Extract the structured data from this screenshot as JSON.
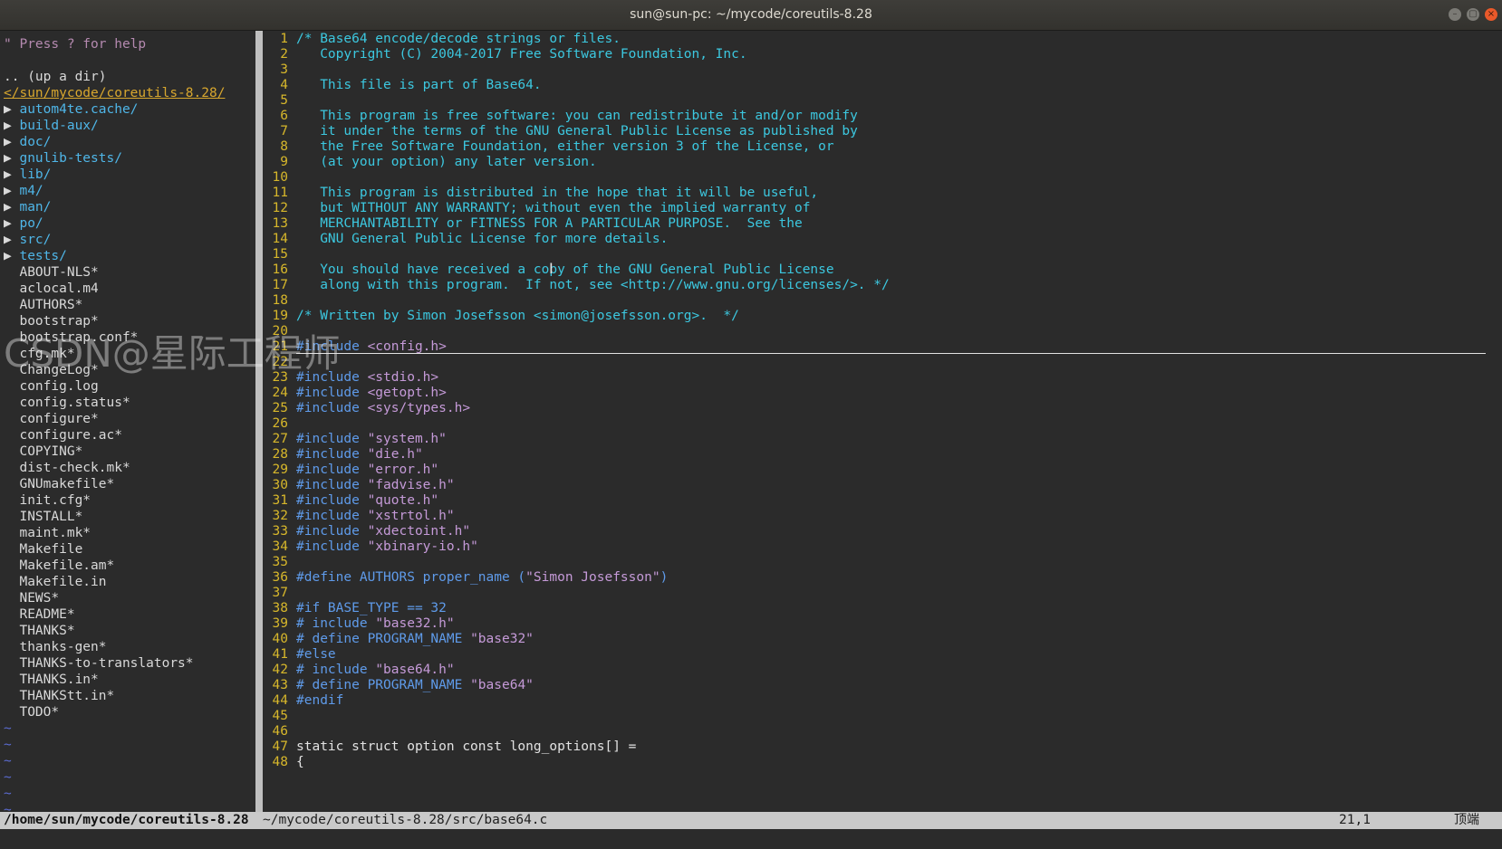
{
  "window": {
    "title": "sun@sun-pc: ~/mycode/coreutils-8.28",
    "controls": {
      "minimize": "–",
      "maximize": "▢",
      "close": "×"
    }
  },
  "tree": {
    "help": "\" Press ? for help",
    "updir": ".. (up a dir)",
    "root": "</sun/mycode/coreutils-8.28/",
    "dirs": [
      "autom4te.cache/",
      "build-aux/",
      "doc/",
      "gnulib-tests/",
      "lib/",
      "m4/",
      "man/",
      "po/",
      "src/",
      "tests/"
    ],
    "dir_arrow": "▶",
    "files": [
      "ABOUT-NLS*",
      "aclocal.m4",
      "AUTHORS*",
      "bootstrap*",
      "bootstrap.conf*",
      "cfg.mk*",
      "ChangeLog*",
      "config.log",
      "config.status*",
      "configure*",
      "configure.ac*",
      "COPYING*",
      "dist-check.mk*",
      "GNUmakefile*",
      "init.cfg*",
      "INSTALL*",
      "maint.mk*",
      "Makefile",
      "Makefile.am*",
      "Makefile.in",
      "NEWS*",
      "README*",
      "THANKS*",
      "thanks-gen*",
      "THANKS-to-translators*",
      "THANKS.in*",
      "THANKStt.in*",
      "TODO*"
    ],
    "tilde": "~"
  },
  "editor": {
    "lines": [
      {
        "n": "1",
        "parts": [
          [
            "c",
            "/* Base64 encode/decode strings or files."
          ]
        ]
      },
      {
        "n": "2",
        "parts": [
          [
            "c",
            "   Copyright (C) 2004-2017 Free Software Foundation, Inc."
          ]
        ]
      },
      {
        "n": "3",
        "parts": []
      },
      {
        "n": "4",
        "parts": [
          [
            "c",
            "   This file is part of Base64."
          ]
        ]
      },
      {
        "n": "5",
        "parts": []
      },
      {
        "n": "6",
        "parts": [
          [
            "c",
            "   This program is free software: you can redistribute it and/or modify"
          ]
        ]
      },
      {
        "n": "7",
        "parts": [
          [
            "c",
            "   it under the terms of the GNU General Public License as published by"
          ]
        ]
      },
      {
        "n": "8",
        "parts": [
          [
            "c",
            "   the Free Software Foundation, either version 3 of the License, or"
          ]
        ]
      },
      {
        "n": "9",
        "parts": [
          [
            "c",
            "   (at your option) any later version."
          ]
        ]
      },
      {
        "n": "10",
        "parts": []
      },
      {
        "n": "11",
        "parts": [
          [
            "c",
            "   This program is distributed in the hope that it will be useful,"
          ]
        ]
      },
      {
        "n": "12",
        "parts": [
          [
            "c",
            "   but WITHOUT ANY WARRANTY; without even the implied warranty of"
          ]
        ]
      },
      {
        "n": "13",
        "parts": [
          [
            "c",
            "   MERCHANTABILITY or FITNESS FOR A PARTICULAR PURPOSE.  See the"
          ]
        ]
      },
      {
        "n": "14",
        "parts": [
          [
            "c",
            "   GNU General Public License for more details."
          ]
        ]
      },
      {
        "n": "15",
        "parts": []
      },
      {
        "n": "16",
        "parts": [
          [
            "c",
            "   You should have received a copy of the GNU General Public License"
          ]
        ]
      },
      {
        "n": "17",
        "parts": [
          [
            "c",
            "   along with this program.  If not, see <http://www.gnu.org/licenses/>. */"
          ]
        ]
      },
      {
        "n": "18",
        "parts": []
      },
      {
        "n": "19",
        "parts": [
          [
            "c",
            "/* Written by Simon Josefsson <simon@josefsson.org>.  */"
          ]
        ]
      },
      {
        "n": "20",
        "parts": []
      },
      {
        "n": "21",
        "parts": [
          [
            "p",
            "#include "
          ],
          [
            "s",
            "<config.h>"
          ]
        ]
      },
      {
        "n": "22",
        "parts": []
      },
      {
        "n": "23",
        "parts": [
          [
            "p",
            "#include "
          ],
          [
            "s",
            "<stdio.h>"
          ]
        ]
      },
      {
        "n": "24",
        "parts": [
          [
            "p",
            "#include "
          ],
          [
            "s",
            "<getopt.h>"
          ]
        ]
      },
      {
        "n": "25",
        "parts": [
          [
            "p",
            "#include "
          ],
          [
            "s",
            "<sys/types.h>"
          ]
        ]
      },
      {
        "n": "26",
        "parts": []
      },
      {
        "n": "27",
        "parts": [
          [
            "p",
            "#include "
          ],
          [
            "s",
            "\"system.h\""
          ]
        ]
      },
      {
        "n": "28",
        "parts": [
          [
            "p",
            "#include "
          ],
          [
            "s",
            "\"die.h\""
          ]
        ]
      },
      {
        "n": "29",
        "parts": [
          [
            "p",
            "#include "
          ],
          [
            "s",
            "\"error.h\""
          ]
        ]
      },
      {
        "n": "30",
        "parts": [
          [
            "p",
            "#include "
          ],
          [
            "s",
            "\"fadvise.h\""
          ]
        ]
      },
      {
        "n": "31",
        "parts": [
          [
            "p",
            "#include "
          ],
          [
            "s",
            "\"quote.h\""
          ]
        ]
      },
      {
        "n": "32",
        "parts": [
          [
            "p",
            "#include "
          ],
          [
            "s",
            "\"xstrtol.h\""
          ]
        ]
      },
      {
        "n": "33",
        "parts": [
          [
            "p",
            "#include "
          ],
          [
            "s",
            "\"xdectoint.h\""
          ]
        ]
      },
      {
        "n": "34",
        "parts": [
          [
            "p",
            "#include "
          ],
          [
            "s",
            "\"xbinary-io.h\""
          ]
        ]
      },
      {
        "n": "35",
        "parts": []
      },
      {
        "n": "36",
        "parts": [
          [
            "p",
            "#define AUTHORS proper_name ("
          ],
          [
            "s",
            "\"Simon Josefsson\""
          ],
          [
            "p",
            ")"
          ]
        ]
      },
      {
        "n": "37",
        "parts": []
      },
      {
        "n": "38",
        "parts": [
          [
            "p",
            "#if BASE_TYPE == 32"
          ]
        ]
      },
      {
        "n": "39",
        "parts": [
          [
            "p",
            "# include "
          ],
          [
            "s",
            "\"base32.h\""
          ]
        ]
      },
      {
        "n": "40",
        "parts": [
          [
            "p",
            "# define PROGRAM_NAME "
          ],
          [
            "s",
            "\"base32\""
          ]
        ]
      },
      {
        "n": "41",
        "parts": [
          [
            "p",
            "#else"
          ]
        ]
      },
      {
        "n": "42",
        "parts": [
          [
            "p",
            "# include "
          ],
          [
            "s",
            "\"base64.h\""
          ]
        ]
      },
      {
        "n": "43",
        "parts": [
          [
            "p",
            "# define PROGRAM_NAME "
          ],
          [
            "s",
            "\"base64\""
          ]
        ]
      },
      {
        "n": "44",
        "parts": [
          [
            "p",
            "#endif"
          ]
        ]
      },
      {
        "n": "45",
        "parts": []
      },
      {
        "n": "46",
        "parts": []
      },
      {
        "n": "47",
        "parts": [
          [
            "t",
            "static struct option const long_options[] ="
          ]
        ]
      },
      {
        "n": "48",
        "parts": [
          [
            "t",
            "{"
          ]
        ]
      }
    ]
  },
  "status": {
    "tree_path": "/home/sun/mycode/coreutils-8.28",
    "file": "~/mycode/coreutils-8.28/src/base64.c",
    "position": "21,1",
    "scroll": "顶端"
  },
  "watermark": "CSDN@星际工程师",
  "colors": {
    "background": "#2b2b2b",
    "comment": "#3cc8e0",
    "preproc": "#5f9bea",
    "string": "#c59ad8",
    "line_number": "#d7b72b",
    "directory": "#4fb6e8",
    "tree_root": "#d8a72e"
  }
}
